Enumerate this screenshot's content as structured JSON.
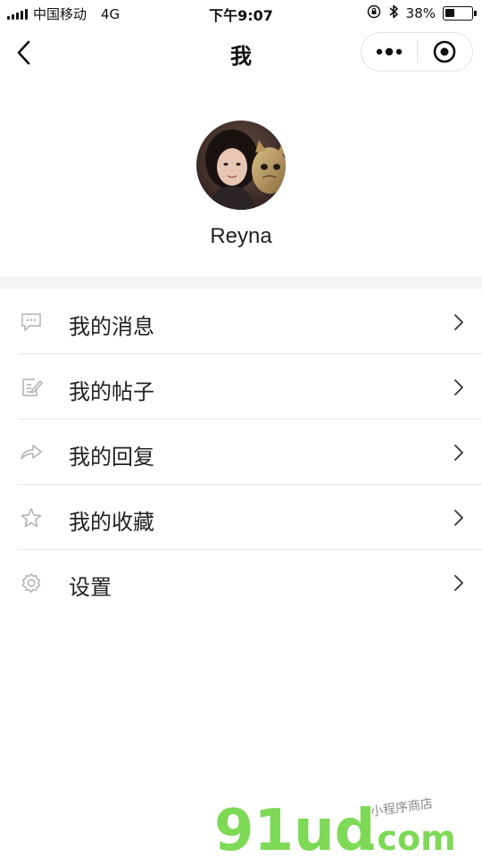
{
  "status_bar": {
    "carrier": "中国移动",
    "network": "4G",
    "time": "下午9:07",
    "battery_percent": "38%",
    "battery_level": 0.38,
    "icons": [
      "signal-icon",
      "rotation-lock-icon",
      "bluetooth-icon",
      "battery-icon"
    ]
  },
  "nav": {
    "title": "我",
    "back_icon": "chevron-left-icon",
    "more_icon": "more-dots-icon",
    "close_icon": "target-circle-icon"
  },
  "profile": {
    "username": "Reyna"
  },
  "menu": {
    "items": [
      {
        "label": "我的消息",
        "icon": "message-icon"
      },
      {
        "label": "我的帖子",
        "icon": "post-edit-icon"
      },
      {
        "label": "我的回复",
        "icon": "reply-arrow-icon"
      },
      {
        "label": "我的收藏",
        "icon": "star-icon"
      },
      {
        "label": "设置",
        "icon": "gear-icon"
      }
    ]
  },
  "watermark": {
    "brand": "91ud",
    "domain": ".com",
    "tagline": "小程序商店"
  },
  "colors": {
    "watermark_green": "#7ed957",
    "divider": "#e6e6e6",
    "icon_gray": "#b0b0b0",
    "section_gap": "#f4f4f4"
  }
}
